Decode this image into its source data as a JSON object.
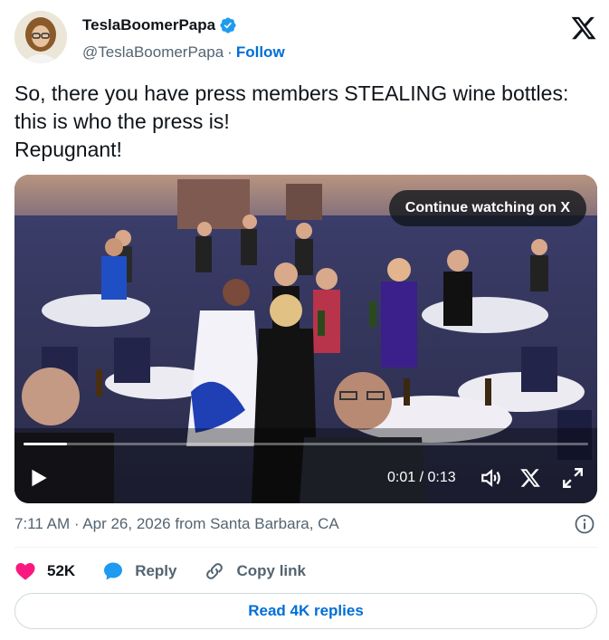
{
  "author": {
    "display_name": "TeslaBoomerPapa",
    "handle": "@TeslaBoomerPapa",
    "separator": "·",
    "follow_label": "Follow",
    "verified": true
  },
  "tweet": {
    "text": "So, there you have press members STEALING wine bottles:\nthis is who the press is!\nRepugnant!"
  },
  "media": {
    "continue_label": "Continue watching on X",
    "time_display": "0:01 / 0:13",
    "progress_fraction": 0.077
  },
  "meta": {
    "timestamp": "7:11 AM · Apr 26, 2026 from Santa Barbara, CA"
  },
  "actions": {
    "likes": "52K",
    "reply_label": "Reply",
    "copy_link_label": "Copy link"
  },
  "replies_button": "Read 4K replies",
  "colors": {
    "accent": "#006fd6",
    "like": "#f91880",
    "verified": "#1d9bf0"
  }
}
